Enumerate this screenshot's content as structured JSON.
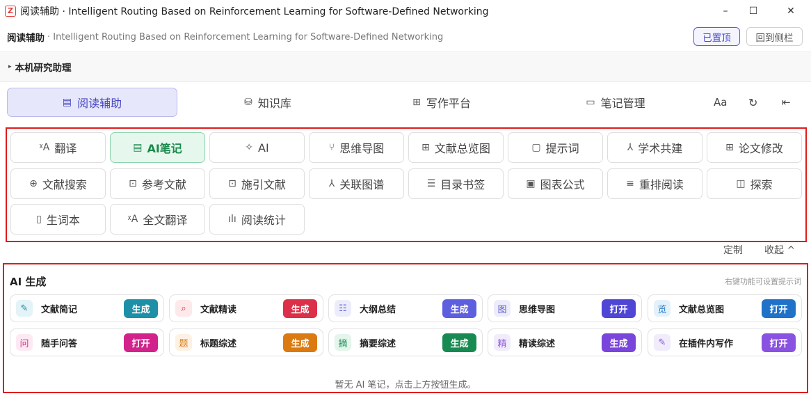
{
  "window": {
    "logo": "Z",
    "title": "阅读辅助 · Intelligent Routing Based on Reinforcement Learning for Software-Defined Networking",
    "controls": {
      "minimize": "–",
      "maximize": "☐",
      "close": "✕"
    }
  },
  "header": {
    "name": "阅读辅助",
    "subtitle": "· Intelligent Routing Based on Reinforcement Learning for Software-Defined Networking",
    "pin_label": "已置顶",
    "sidebar_label": "回到侧栏"
  },
  "assistant": {
    "toggle_icon": "▸",
    "label": "本机研究助理"
  },
  "tabs": [
    {
      "label": "阅读辅助",
      "icon": "document-icon",
      "glyph": "▤",
      "active": true
    },
    {
      "label": "知识库",
      "icon": "database-icon",
      "glyph": "⛁"
    },
    {
      "label": "写作平台",
      "icon": "grid-icon",
      "glyph": "⊞"
    },
    {
      "label": "笔记管理",
      "icon": "folder-icon",
      "glyph": "▭"
    }
  ],
  "toolbar": {
    "font_label": "Aa",
    "refresh_glyph": "↻",
    "collapse_glyph": "⇤"
  },
  "tools": [
    {
      "label": "翻译",
      "icon": "translate-icon",
      "glyph": "ᵡA"
    },
    {
      "label": "AI笔记",
      "icon": "note-icon",
      "glyph": "▤",
      "active": true
    },
    {
      "label": "AI",
      "icon": "sparkle-icon",
      "glyph": "✧"
    },
    {
      "label": "思维导图",
      "icon": "mindmap-icon",
      "glyph": "⑂"
    },
    {
      "label": "文献总览图",
      "icon": "grid-icon",
      "glyph": "⊞"
    },
    {
      "label": "提示词",
      "icon": "prompt-icon",
      "glyph": "▢"
    },
    {
      "label": "学术共建",
      "icon": "share-icon",
      "glyph": "⅄"
    },
    {
      "label": "论文修改",
      "icon": "grid-icon",
      "glyph": "⊞"
    },
    {
      "label": "文献搜索",
      "icon": "search-icon",
      "glyph": "⊕"
    },
    {
      "label": "参考文献",
      "icon": "reference-icon",
      "glyph": "⊡"
    },
    {
      "label": "施引文献",
      "icon": "citation-icon",
      "glyph": "⊡"
    },
    {
      "label": "关联图谱",
      "icon": "graph-icon",
      "glyph": "⅄"
    },
    {
      "label": "目录书签",
      "icon": "list-icon",
      "glyph": "☰"
    },
    {
      "label": "图表公式",
      "icon": "image-icon",
      "glyph": "▣"
    },
    {
      "label": "重排阅读",
      "icon": "reflow-icon",
      "glyph": "≡"
    },
    {
      "label": "探索",
      "icon": "book-icon",
      "glyph": "◫"
    },
    {
      "label": "生词本",
      "icon": "notebook-icon",
      "glyph": "▯"
    },
    {
      "label": "全文翻译",
      "icon": "translate-icon",
      "glyph": "ᵡA"
    },
    {
      "label": "阅读统计",
      "icon": "stats-icon",
      "glyph": "ılı"
    }
  ],
  "panel_controls": {
    "customize": "定制",
    "fold": "收起 ^"
  },
  "ai": {
    "title": "AI 生成",
    "hint": "右键功能可设置提示词",
    "cards": [
      {
        "label": "文献简记",
        "icon": "pen-icon",
        "glyph": "✎",
        "icon_bg": "#e3f3f7",
        "icon_color": "#1f8fa8",
        "action": "生成",
        "action_color": "#1d8fa6"
      },
      {
        "label": "文献精读",
        "icon": "search-icon",
        "glyph": "⌕",
        "icon_bg": "#fde8ea",
        "icon_color": "#d9304a",
        "action": "生成",
        "action_color": "#dc2f48"
      },
      {
        "label": "大纲总结",
        "icon": "outline-icon",
        "glyph": "☷",
        "icon_bg": "#ececfb",
        "icon_color": "#6a6ad8",
        "action": "生成",
        "action_color": "#5e5fdf"
      },
      {
        "label": "思维导图",
        "icon": "chart-icon",
        "glyph": "图",
        "icon_bg": "#ececfb",
        "icon_color": "#6060cf",
        "action": "打开",
        "action_color": "#5046d6"
      },
      {
        "label": "文献总览图",
        "icon": "overview-icon",
        "glyph": "览",
        "icon_bg": "#e3f1fb",
        "icon_color": "#2a7dc2",
        "action": "打开",
        "action_color": "#1f72c8"
      },
      {
        "label": "随手问答",
        "icon": "ask-icon",
        "glyph": "问",
        "icon_bg": "#fde9f3",
        "icon_color": "#d3318b",
        "action": "打开",
        "action_color": "#d2238b"
      },
      {
        "label": "标题综述",
        "icon": "topic-icon",
        "glyph": "题",
        "icon_bg": "#fdf1e3",
        "icon_color": "#d9801f",
        "action": "生成",
        "action_color": "#db7a10"
      },
      {
        "label": "摘要综述",
        "icon": "abstract-icon",
        "glyph": "摘",
        "icon_bg": "#e4f5ec",
        "icon_color": "#1d9158",
        "action": "生成",
        "action_color": "#178a51"
      },
      {
        "label": "精读综述",
        "icon": "review-icon",
        "glyph": "精",
        "icon_bg": "#f1ecfb",
        "icon_color": "#8a5ad6",
        "action": "生成",
        "action_color": "#7a45db"
      },
      {
        "label": "在插件内写作",
        "icon": "pen-icon",
        "glyph": "✎",
        "icon_bg": "#f1ecfb",
        "icon_color": "#8a5ad6",
        "action": "打开",
        "action_color": "#8a52e0"
      }
    ],
    "empty": "暂无 AI 笔记，点击上方按钮生成。"
  }
}
